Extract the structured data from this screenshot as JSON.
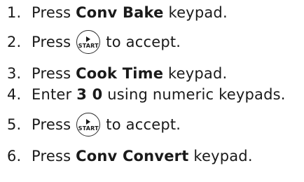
{
  "steps": [
    {
      "number": "1.",
      "pre": "Press ",
      "bold": "Conv Bake",
      "post": " keypad."
    },
    {
      "number": "2.",
      "pre": "Press",
      "button": "START",
      "post": "to accept."
    },
    {
      "number": "3.",
      "pre": "Press ",
      "bold": "Cook Time",
      "post": " keypad."
    },
    {
      "number": "4.",
      "pre": "Enter ",
      "bold": "3 0",
      "post": " using numeric keypads."
    },
    {
      "number": "5.",
      "pre": "Press",
      "button": "START",
      "post": "to accept."
    },
    {
      "number": "6.",
      "pre": "Press ",
      "bold": "Conv Convert",
      "post": " keypad."
    }
  ],
  "icons": {
    "start_button": "play-triangle-icon"
  }
}
